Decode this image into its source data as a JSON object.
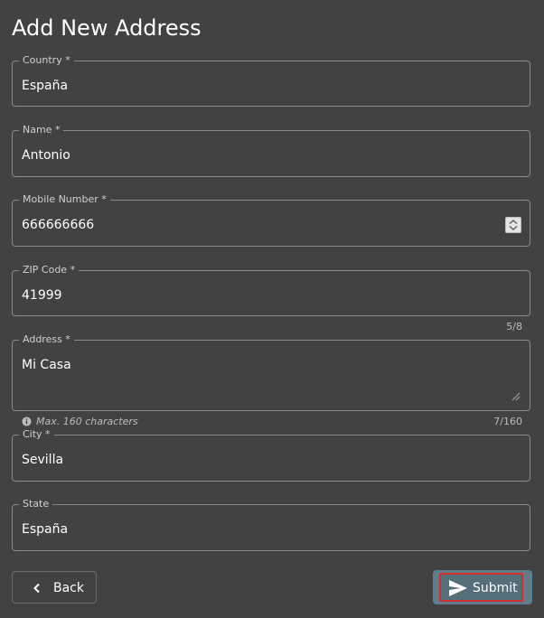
{
  "page": {
    "title": "Add New Address"
  },
  "fields": {
    "country": {
      "label": "Country *",
      "value": "España"
    },
    "name": {
      "label": "Name *",
      "value": "Antonio"
    },
    "mobile": {
      "label": "Mobile Number *",
      "value": "666666666"
    },
    "zip": {
      "label": "ZIP Code *",
      "value": "41999",
      "counter": "5/8"
    },
    "address": {
      "label": "Address *",
      "value": "Mi Casa",
      "hint": "Max. 160 characters",
      "counter": "7/160"
    },
    "city": {
      "label": "City *",
      "value": "Sevilla"
    },
    "state": {
      "label": "State",
      "value": "España"
    }
  },
  "actions": {
    "back_label": "Back",
    "submit_label": "Submit"
  },
  "colors": {
    "background": "#424242",
    "submit": "#546e7a",
    "focus_outline": "#d32f2f"
  },
  "icons": {
    "back": "chevron-left-icon",
    "submit": "send-icon",
    "hint": "info-icon"
  }
}
